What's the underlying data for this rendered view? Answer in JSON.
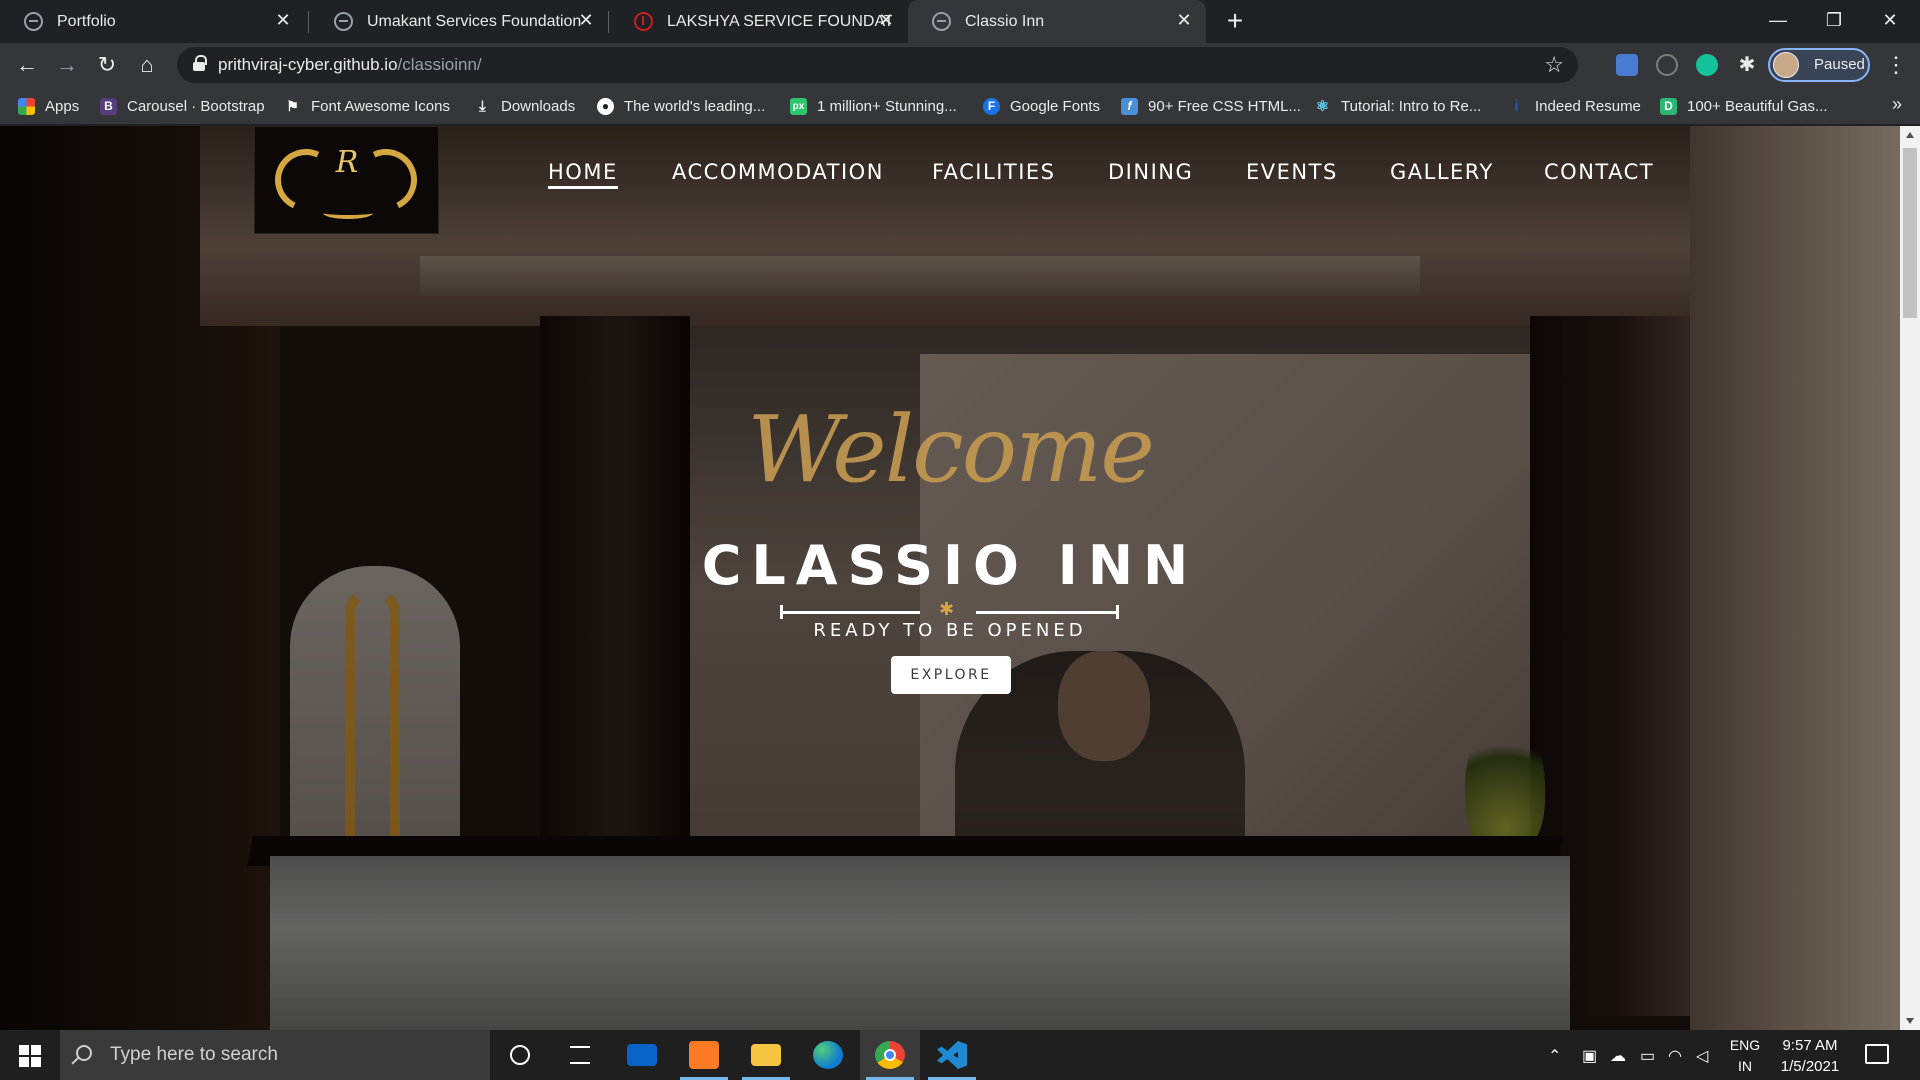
{
  "browser": {
    "tabs": [
      {
        "title": "Portfolio",
        "favicon": "globe-icon"
      },
      {
        "title": "Umakant Services Foundation",
        "favicon": "globe-icon"
      },
      {
        "title": "LAKSHYA SERVICE FOUNDATION",
        "favicon": "red-circle-icon"
      },
      {
        "title": "Classio Inn",
        "favicon": "globe-icon",
        "active": true
      }
    ],
    "url_host": "prithviraj-cyber.github.io",
    "url_path": "/classioinn/",
    "profile_label": "Paused",
    "accent": "#8ab4f8"
  },
  "bookmarks": [
    {
      "label": "Apps",
      "icon": "apps-grid-icon",
      "color": "#e8453c"
    },
    {
      "label": "Carousel · Bootstrap",
      "icon": "bootstrap-icon",
      "color": "#563d7c"
    },
    {
      "label": "Font Awesome Icons",
      "icon": "flag-icon",
      "color": "#ffffff"
    },
    {
      "label": "Downloads",
      "icon": "download-icon",
      "color": "#e8eaed"
    },
    {
      "label": "The world's leading...",
      "icon": "github-icon",
      "color": "#ffffff"
    },
    {
      "label": "1 million+ Stunning...",
      "icon": "pixabay-icon",
      "color": "#2ec66d"
    },
    {
      "label": "Google Fonts",
      "icon": "google-fonts-icon",
      "color": "#1a73e8"
    },
    {
      "label": "90+ Free CSS HTML...",
      "icon": "css-icon",
      "color": "#4a90d9"
    },
    {
      "label": "Tutorial: Intro to Re...",
      "icon": "react-icon",
      "color": "#61dafb"
    },
    {
      "label": "Indeed Resume",
      "icon": "indeed-icon",
      "color": "#2557a7"
    },
    {
      "label": "100+ Beautiful Gas...",
      "icon": "d-icon",
      "color": "#2bb673"
    }
  ],
  "site": {
    "nav": [
      "HOME",
      "ACCOMMODATION",
      "FACILITIES",
      "DINING",
      "EVENTS",
      "GALLERY",
      "CONTACT"
    ],
    "active_nav": "HOME",
    "logo_monogram": "R",
    "hero": {
      "welcome": "Welcome",
      "title": "CLASSIO INN",
      "subtitle": "READY TO BE OPENED",
      "button": "EXPLORE"
    },
    "gold": "#c49a52"
  },
  "taskbar": {
    "search_placeholder": "Type here to search",
    "apps": [
      "cortana-icon",
      "task-view-icon",
      "mail-icon",
      "xampp-icon",
      "file-explorer-icon",
      "edge-icon",
      "chrome-icon",
      "vscode-icon"
    ],
    "lang_top": "ENG",
    "lang_bottom": "IN",
    "time": "9:57 AM",
    "date": "1/5/2021"
  }
}
